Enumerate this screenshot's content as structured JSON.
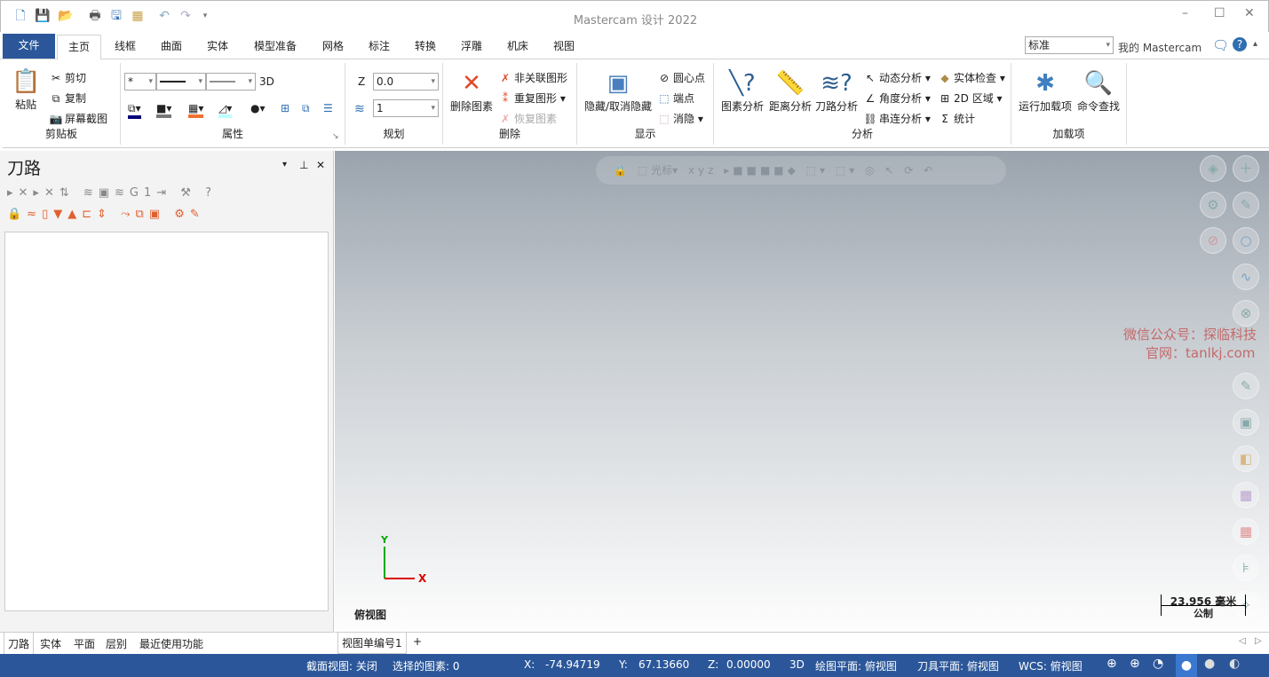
{
  "title": "Mastercam 设计 2022",
  "tabs": [
    "文件",
    "主页",
    "线框",
    "曲面",
    "实体",
    "模型准备",
    "网格",
    "标注",
    "转换",
    "浮雕",
    "机床",
    "视图"
  ],
  "style_select": "标准",
  "my_mastercam": "我的 Mastercam",
  "clipboard": {
    "label": "剪贴板",
    "paste": "粘贴",
    "cut": "剪切",
    "copy": "复制",
    "screenshot": "屏幕截图"
  },
  "attributes": {
    "label": "属性",
    "mode": "3D"
  },
  "planning": {
    "label": "规划",
    "z_label": "Z",
    "z_value": "0.0",
    "level_value": "1"
  },
  "delete": {
    "label": "删除",
    "delete_entity": "删除图素",
    "unassoc": "非关联图形",
    "duplicate": "重复图形",
    "restore": "恢复图素"
  },
  "display": {
    "label": "显示",
    "hide": "隐藏/取消隐藏",
    "center": "圆心点",
    "endpoint": "端点",
    "blank": "消隐"
  },
  "analyze": {
    "label": "分析",
    "entity": "图素分析",
    "distance": "距离分析",
    "toolpath": "刀路分析",
    "dynamic": "动态分析",
    "angle": "角度分析",
    "chain": "串连分析",
    "solid_check": "实体检查",
    "area2d": "2D 区域",
    "stats": "统计"
  },
  "addins": {
    "label": "加载项",
    "run": "运行加载项",
    "find": "命令查找"
  },
  "panel": {
    "title": "刀路",
    "bottom_tabs": [
      "刀路",
      "实体",
      "平面",
      "层别",
      "最近使用功能"
    ]
  },
  "viewport": {
    "cursor_label": "光标",
    "view_name": "俯视图",
    "watermark1": "微信公众号：探临科技",
    "watermark2": "官网：tanlkj.com",
    "scale": "23.956 毫米",
    "units": "公制",
    "axis_x": "X",
    "axis_y": "Y",
    "viewsheet": "视图单编号1",
    "add": "+"
  },
  "status": {
    "section": "截面视图: 关闭",
    "selected": "选择的图素: 0",
    "x_label": "X:",
    "x": "-74.94719",
    "y_label": "Y:",
    "y": "67.13660",
    "z_label": "Z:",
    "z": "0.00000",
    "mode": "3D",
    "cplane": "绘图平面: 俯视图",
    "tplane": "刀具平面: 俯视图",
    "wcs": "WCS: 俯视图"
  }
}
